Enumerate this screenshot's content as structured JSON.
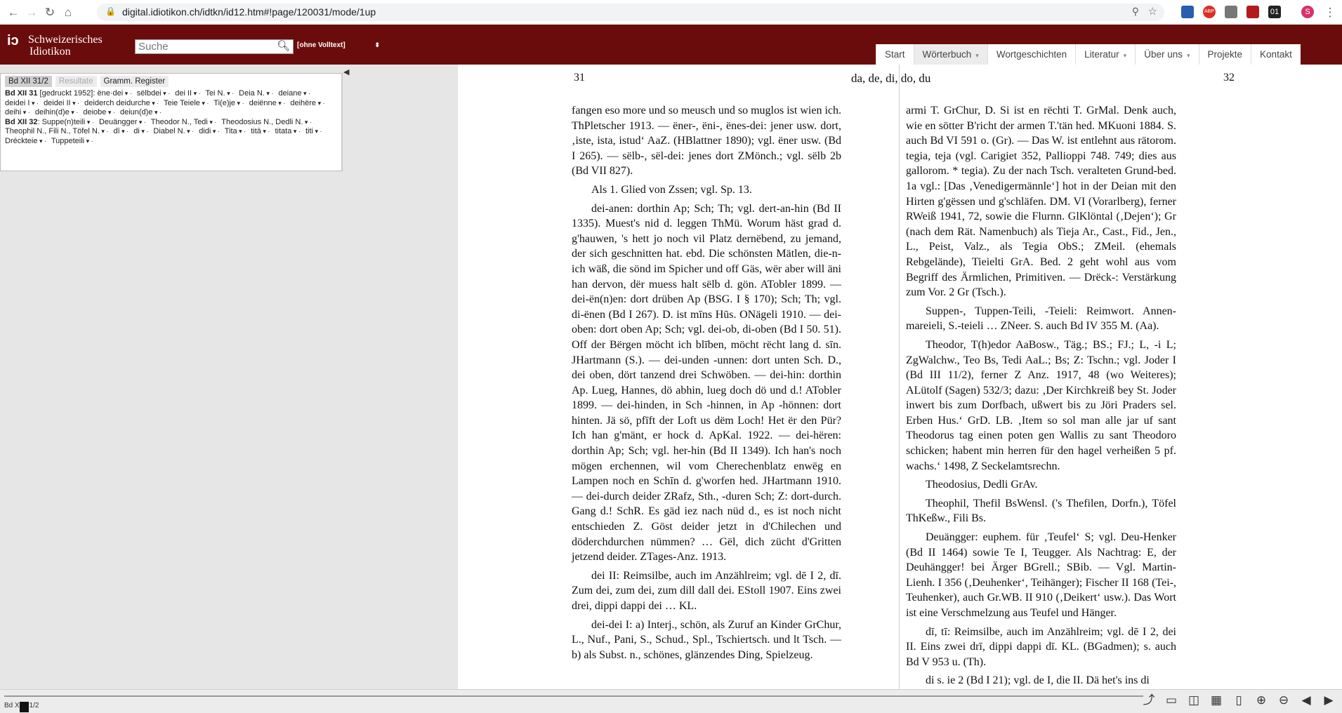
{
  "browser": {
    "url": "digital.idiotikon.ch/idtkn/id12.htm#!page/120031/mode/1up",
    "extensions": [
      "",
      "ABP",
      "",
      "",
      "01",
      "S"
    ]
  },
  "header": {
    "logo_line1": "Schweizerisches",
    "logo_line2": "Idiotikon",
    "search_placeholder": "Suche",
    "volltext_label": "[ohne Volltext]",
    "menu": [
      {
        "label": "Start"
      },
      {
        "label": "Wörterbuch"
      },
      {
        "label": "Wortgeschichten"
      },
      {
        "label": "Literatur"
      },
      {
        "label": "Über uns"
      },
      {
        "label": "Projekte"
      },
      {
        "label": "Kontakt"
      }
    ]
  },
  "panel": {
    "tabs": [
      "Bd XII 31/2",
      "Resultate",
      "Gramm. Register"
    ],
    "vol31_head": "Bd XII 31",
    "vol31_note": "[gedruckt 1952]:",
    "vol31_entries": [
      "ëne·dei",
      "sëlbdei",
      "dei II",
      "Tei N.",
      "Deia N.",
      "deiane",
      "deidei I",
      "deidei II",
      "deiderch deidurche",
      "Teie Teiele",
      "Ti(e)je",
      "deiënne",
      "deihëre",
      "deihi",
      "deihin(d)e",
      "deiobe",
      "deiun(d)e"
    ],
    "vol32_head": "Bd XII 32",
    "vol32_entries": [
      "Suppe(n)teili",
      "Deuängger",
      "Theodor N., Tedi",
      "Theodosius N., Dedli N.",
      "Theophil N., Fili N., Töfel N.",
      "dī",
      "di",
      "Diabel N.",
      "didi",
      "Tita",
      "titā",
      "titata",
      "titi",
      "Dréckteie",
      "Tuppeteili"
    ]
  },
  "page": {
    "left_number": "31",
    "headwords": "da, de, di, do, du",
    "right_number": "32",
    "left_column": [
      "fangen eso more und so meusch und so muglos ist wien ich. ThPletscher 1913. — ëner-, ëni-, ënes-dei: jener usw. dort, ‚iste, ista, istud‘ AaZ. (HBlattner 1890); vgl. ëner usw. (Bd I 265). — sëlb-, sël-dei: jenes dort ZMönch.; vgl. sëlb 2b (Bd VII 827).",
      "Als 1. Glied von Zssen; vgl. Sp. 13.",
      "dei-anen: dorthin Ap; Sch; Th; vgl. dert-an-hin (Bd II 1335). Muest's nid d. leggen ThMü. Worum häst grad d. g'hauwen, 's hett jo noch vil Platz dernëbend, zu jemand, der sich geschnitten hat. ebd. Die schönsten Mätlen, die-n-ich wäß, die sönd im Spicher und off Gäs, wër aber will äni han dervon, dër muess halt sëlb d. gön. ATobler 1899. — dei-ën(n)en: dort drüben Ap (BSG. I § 170); Sch; Th; vgl. di-ënen (Bd I 267). D. ist mīns Hūs. ONägeli 1910. — dei-oben: dort oben Ap; Sch; vgl. dei-ob, di-oben (Bd I 50. 51). Off der Bërgen möcht ich blīben, möcht rëcht lang d. sīn. JHartmann (S.). — dei-unden -unnen: dort unten Sch. D., dei oben, dört tanzend drei Schwöben. — dei-hin: dorthin Ap. Lueg, Hannes, dö abhin, lueg doch dö und d.! ATobler 1899. — dei-hinden, in Sch -hinnen, in Ap -hönnen: dort hinten. Jä sö, pfīft der Loft us dëm Loch! Het ër den Pür? Ich han g'mänt, er hock d. ApKal. 1922. — dei-hëren: dorthin Ap; Sch; vgl. her-hin (Bd II 1349). Ich han's noch mögen erchennen, wil vom Cherechenblatz enwëg en Lampen noch en Schīn d. g'worfen hed. JHartmann 1910. — dei-durch deider ZRafz, Sth., -duren Sch; Z: dort-durch. Gang d.! SchR. Es gäd iez nach nüd d., es ist noch nicht entschieden Z. Göst deider jetzt in d'Chilechen und döderchdurchen nümmen? … Gël, dich zücht d'Gritten jetzend deider. ZTages-Anz. 1913.",
      "dei II: Reimsilbe, auch im Anzählreim; vgl. dē I 2, dī. Zum dei, zum dei, zum dill dall dei. EStoll 1907. Eins zwei drei, dippi dappi dei … KL.",
      "dei-dei I: a) Interj., schön, als Zuruf an Kinder GrChur, L., Nuf., Pani, S., Schud., Spl., Tschiertsch. und lt Tsch. — b) als Subst. n., schönes, glänzendes Ding, Spielzeug."
    ],
    "right_column": [
      "armi T. GrChur, D. Si ist en rëchti T. GrMal. Denk auch, wie en sötter B'richt der armen T.'tän hed. MKuoni 1884. S. auch Bd VI 591 o. (Gr). — Das W. ist entlehnt aus rätorom. tegia, teja (vgl. Carigiet 352, Pallioppi 748. 749; dies aus gallorom. * tegia). Zu der nach Tsch. veralteten Grund-bed. 1a vgl.: [Das ‚Venedigermännle‘] hot in der Deian mit den Hirten g'gëssen und g'schläfen. DM. VI (Vorarlberg), ferner RWeiß 1941, 72, sowie die Flurnn. GlKlöntal (‚Dejen‘); Gr (nach dem Rät. Namenbuch) als Tieja Ar., Cast., Fid., Jen., L., Peist, Valz., als Tegia ObS.; ZMeil. (ehemals Rebgelände), Tieielti GrA. Bed. 2 geht wohl aus vom Begriff des Ärmlichen, Primitiven. — Drëck-: Verstärkung zum Vor. 2 Gr (Tsch.).",
      "Suppen-, Tuppen-Teili, -Teieli: Reimwort. Annen-mareieli, S.-teieli … ZNeer. S. auch Bd IV 355 M. (Aa).",
      "Theodor, T(h)edor AaBosw., Täg.; BS.; FJ.; L, -i L; ZgWalchw., Teo Bs, Tedi AaL.; Bs; Z: Tschn.; vgl. Joder I (Bd III 11/2), ferner Z Anz. 1917, 48 (wo Weiteres); ALütolf (Sagen) 532/3; dazu: ‚Der Kirchkreiß bey St. Joder inwert bis zum Dorfbach, ußwert bis zu Jöri Praders sel. Erben Hus.‘ GrD. LB. ‚Item so sol man alle jar uf sant Theodorus tag einen poten gen Wallis zu sant Theodoro schicken; habent min herren für den hagel verheißen 5 pf. wachs.‘ 1498, Z Seckelamtsrechn.",
      "Theodosius, Dedli GrAv.",
      "Theophil, Thefil BsWensl. ('s Thefilen, Dorfn.), Töfel ThKeßw., Fili Bs.",
      "Deuängger: euphem. für ‚Teufel‘ S; vgl. Deu-Henker (Bd II 1464) sowie Te I, Teugger. Als Nachtrag: E, der Deuhängger! bei Ärger BGrell.; SBib. — Vgl. Martin-Lienh. I 356 (‚Deuhenker‘, Teihänger); Fischer II 168 (Tei-, Teuhenker), auch Gr.WB. II 910 (‚Deikert‘ usw.). Das Wort ist eine Verschmelzung aus Teufel und Hänger.",
      "dī, tī: Reimsilbe, auch im Anzählreim; vgl. dē I 2, dei II. Eins zwei drī, dippi dappi dī. KL. (BGadmen); s. auch Bd V 953 u. (Th).",
      "di s. ie 2 (Bd I 21); vgl. de I, die II. Dä het's ins di"
    ]
  },
  "bottom": {
    "page_indicator": "Bd XII 31/2"
  }
}
